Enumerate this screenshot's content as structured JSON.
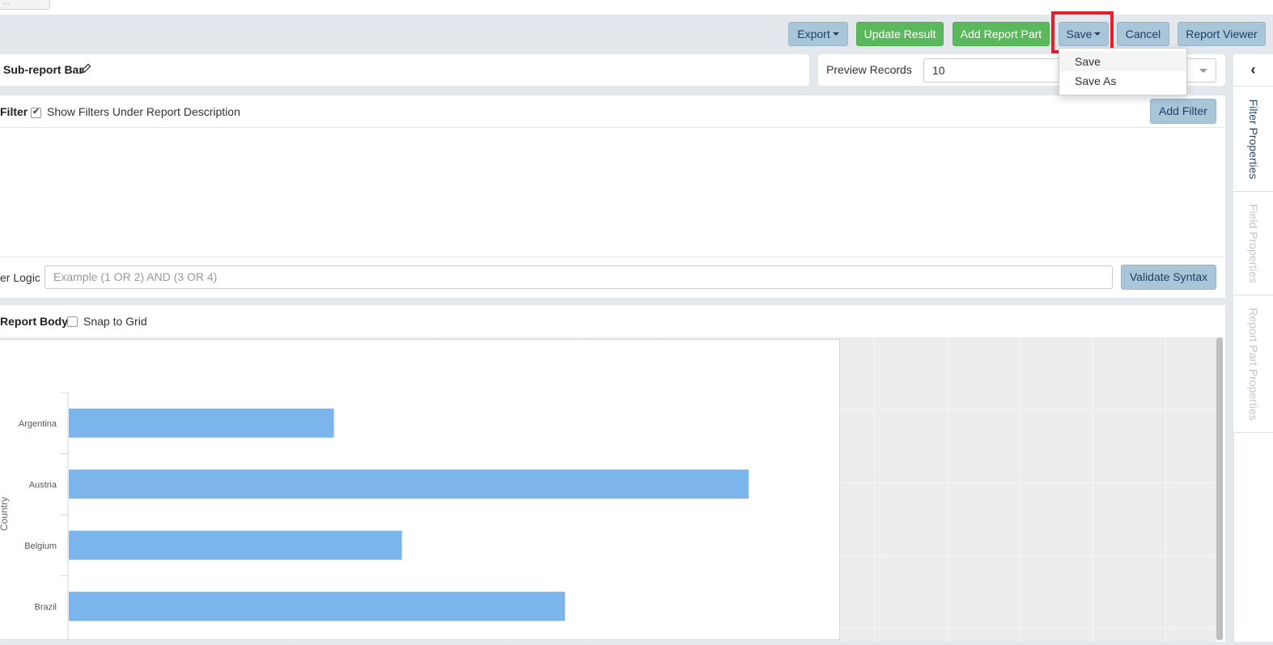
{
  "top_tab": {
    "label": "..."
  },
  "toolbar": {
    "export_label": "Export",
    "update_result_label": "Update Result",
    "add_report_part_label": "Add Report Part",
    "save_label": "Save",
    "cancel_label": "Cancel",
    "report_viewer_label": "Report Viewer"
  },
  "save_menu": {
    "items": [
      "Save",
      "Save As"
    ]
  },
  "report": {
    "title": "Sub-report Bar"
  },
  "preview": {
    "label": "Preview Records",
    "value": "10"
  },
  "filter": {
    "label": "Filter",
    "show_filters_label": "Show Filters Under Report Description",
    "show_filters_checked": true,
    "add_filter_label": "Add Filter",
    "logic_label": "er Logic",
    "logic_placeholder": "Example (1 OR 2) AND (3 OR 4)",
    "validate_label": "Validate Syntax"
  },
  "report_body": {
    "label": "Report Body",
    "snap_to_grid_label": "Snap to Grid",
    "snap_checked": false
  },
  "sidebar": {
    "tabs": [
      {
        "label": "Filter Properties",
        "active": true
      },
      {
        "label": "Field Properties",
        "active": false
      },
      {
        "label": "Report Part Properties",
        "active": false
      }
    ]
  },
  "colors": {
    "bar": "#7cb5ec",
    "green": "#5cb85c",
    "blue_button": "#a9c6d9",
    "highlight": "#e0202a"
  },
  "chart_data": {
    "type": "bar",
    "orientation": "horizontal",
    "categories": [
      "Argentina",
      "Austria",
      "Belgium",
      "Brazil"
    ],
    "values": [
      39,
      100,
      49,
      73
    ],
    "ylabel": "Country",
    "color": "#7cb5ec"
  }
}
